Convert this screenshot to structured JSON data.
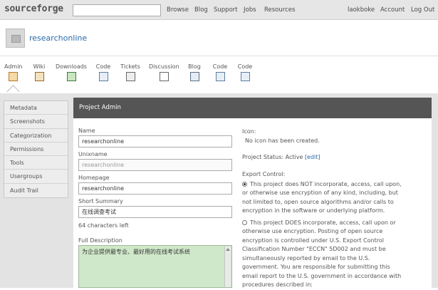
{
  "topbar": {
    "logo": "sourceforge",
    "search_placeholder": "",
    "nav": [
      "Browse",
      "Blog",
      "Support",
      "Jobs",
      "Resources"
    ],
    "user": "laokboke",
    "account": "Account",
    "logout": "Log Out"
  },
  "project": {
    "name": "researchonline"
  },
  "tools": [
    "Admin",
    "Wiki",
    "Downloads",
    "Code",
    "Tickets",
    "Discussion",
    "Blog",
    "Code",
    "Code"
  ],
  "sidebar": {
    "items": [
      "Metadata",
      "Screenshots",
      "Categorization",
      "Permissions",
      "Tools",
      "Usergroups",
      "Audit Trail"
    ]
  },
  "panel": {
    "title": "Project Admin",
    "name_label": "Name",
    "name_value": "researchonline",
    "unixname_label": "Unixname",
    "unixname_value": "researchonline",
    "homepage_label": "Homepage",
    "homepage_value": "researchonline",
    "summary_label": "Short Summary",
    "summary_value": "在线调查考试",
    "chars_left": "64 characters left",
    "description_label": "Full Description",
    "description_value": "为企业提供最专业、最好用的在线考试系统",
    "icon_label": "Icon:",
    "icon_text": "No icon has been created.",
    "status_label": "Project Status: Active",
    "status_edit": "[edit]",
    "export_label": "Export Control:",
    "export_option1": "This project does NOT incorporate, access, call upon, or otherwise use encryption of any kind, including, but not limited to, open source algorithms and/or calls to encryption in the software or underlying platform.",
    "export_option2": "This project DOES incorporate, access, call upon or otherwise use encryption. Posting of open source encryption is controlled under U.S. Export Control Classification Number \"ECCN\" 5D002 and must be simultaneously reported by email to the U.S. government. You are responsible for submitting this email report to the U.S. government in accordance with procedures described in:"
  }
}
